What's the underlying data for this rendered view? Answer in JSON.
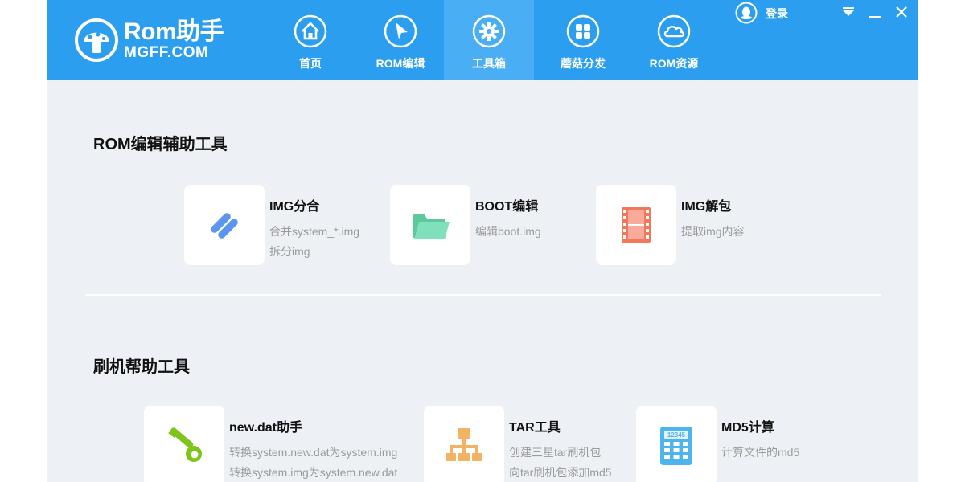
{
  "header": {
    "logo": {
      "brand": "Rom助手",
      "domain": "MGFF.COM"
    },
    "nav": [
      {
        "label": "首页",
        "icon": "home-icon"
      },
      {
        "label": "ROM编辑",
        "icon": "cursor-arrow-icon"
      },
      {
        "label": "工具箱",
        "icon": "gear-icon",
        "active": true
      },
      {
        "label": "蘑菇分发",
        "icon": "grid-icon"
      },
      {
        "label": "ROM资源",
        "icon": "cloud-icon"
      }
    ],
    "login_label": "登录",
    "window_buttons": [
      "dropdown-icon",
      "minimize-icon",
      "close-icon"
    ]
  },
  "sections": [
    {
      "title": "ROM编辑辅助工具",
      "tools": [
        {
          "name": "IMG分合",
          "desc": [
            "合并system_*.img",
            "拆分img"
          ],
          "icon": "link-icon",
          "color": "#5b95f0"
        },
        {
          "name": "BOOT编辑",
          "desc": [
            "编辑boot.img"
          ],
          "icon": "folder-icon",
          "color": "#6fd9b0"
        },
        {
          "name": "IMG解包",
          "desc": [
            "提取img内容"
          ],
          "icon": "film-icon",
          "color": "#f3775b"
        }
      ]
    },
    {
      "title": "刷机帮助工具",
      "tools": [
        {
          "name": "new.dat助手",
          "desc": [
            "转换system.new.dat为system.img",
            "转换system.img为system.new.dat"
          ],
          "icon": "wrench-icon",
          "color": "#7ec41d"
        },
        {
          "name": "TAR工具",
          "desc": [
            "创建三星tar刷机包",
            "向tar刷机包添加md5"
          ],
          "icon": "hierarchy-icon",
          "color": "#f4b265"
        },
        {
          "name": "MD5计算",
          "desc": [
            "计算文件的md5"
          ],
          "icon": "calculator-icon",
          "color": "#4eb4ef",
          "icon_text": "12345"
        }
      ]
    }
  ],
  "colors": {
    "header": "#2b9ef0",
    "active_tab": "#4aaef5",
    "content_bg": "#edf1f5"
  }
}
